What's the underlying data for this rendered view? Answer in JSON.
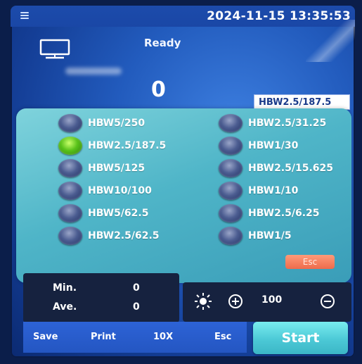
{
  "header": {
    "datetime": "2024-11-15 13:35:53",
    "status": "Ready",
    "value": "0",
    "current_scale": "HBW2.5/187.5"
  },
  "scales": {
    "left": [
      {
        "label": "HBW5/250",
        "selected": false
      },
      {
        "label": "HBW2.5/187.5",
        "selected": true
      },
      {
        "label": "HBW5/125",
        "selected": false
      },
      {
        "label": "HBW10/100",
        "selected": false
      },
      {
        "label": "HBW5/62.5",
        "selected": false
      },
      {
        "label": "HBW2.5/62.5",
        "selected": false
      }
    ],
    "right": [
      {
        "label": "HBW2.5/31.25",
        "selected": false
      },
      {
        "label": "HBW1/30",
        "selected": false
      },
      {
        "label": "HBW2.5/15.625",
        "selected": false
      },
      {
        "label": "HBW1/10",
        "selected": false
      },
      {
        "label": "HBW2.5/6.25",
        "selected": false
      },
      {
        "label": "HBW1/5",
        "selected": false
      }
    ],
    "esc_label": "Esc"
  },
  "stats": {
    "min_label": "Min.",
    "min_value": "0",
    "ave_label": "Ave.",
    "ave_value": "0"
  },
  "light": {
    "value": "100"
  },
  "bottom": {
    "save": "Save",
    "print": "Print",
    "zoom": "10X",
    "esc": "Esc",
    "start": "Start"
  },
  "icons": {
    "menu": "menu-icon",
    "monitor": "monitor-icon",
    "light": "sun-icon",
    "increase": "plus-circle-icon",
    "decrease": "minus-circle-icon"
  },
  "colors": {
    "selected_radio": "#59c21a",
    "panel": "#4fb5c8",
    "start_button": "#4cc9d6",
    "esc_button": "#ee6b4c"
  }
}
